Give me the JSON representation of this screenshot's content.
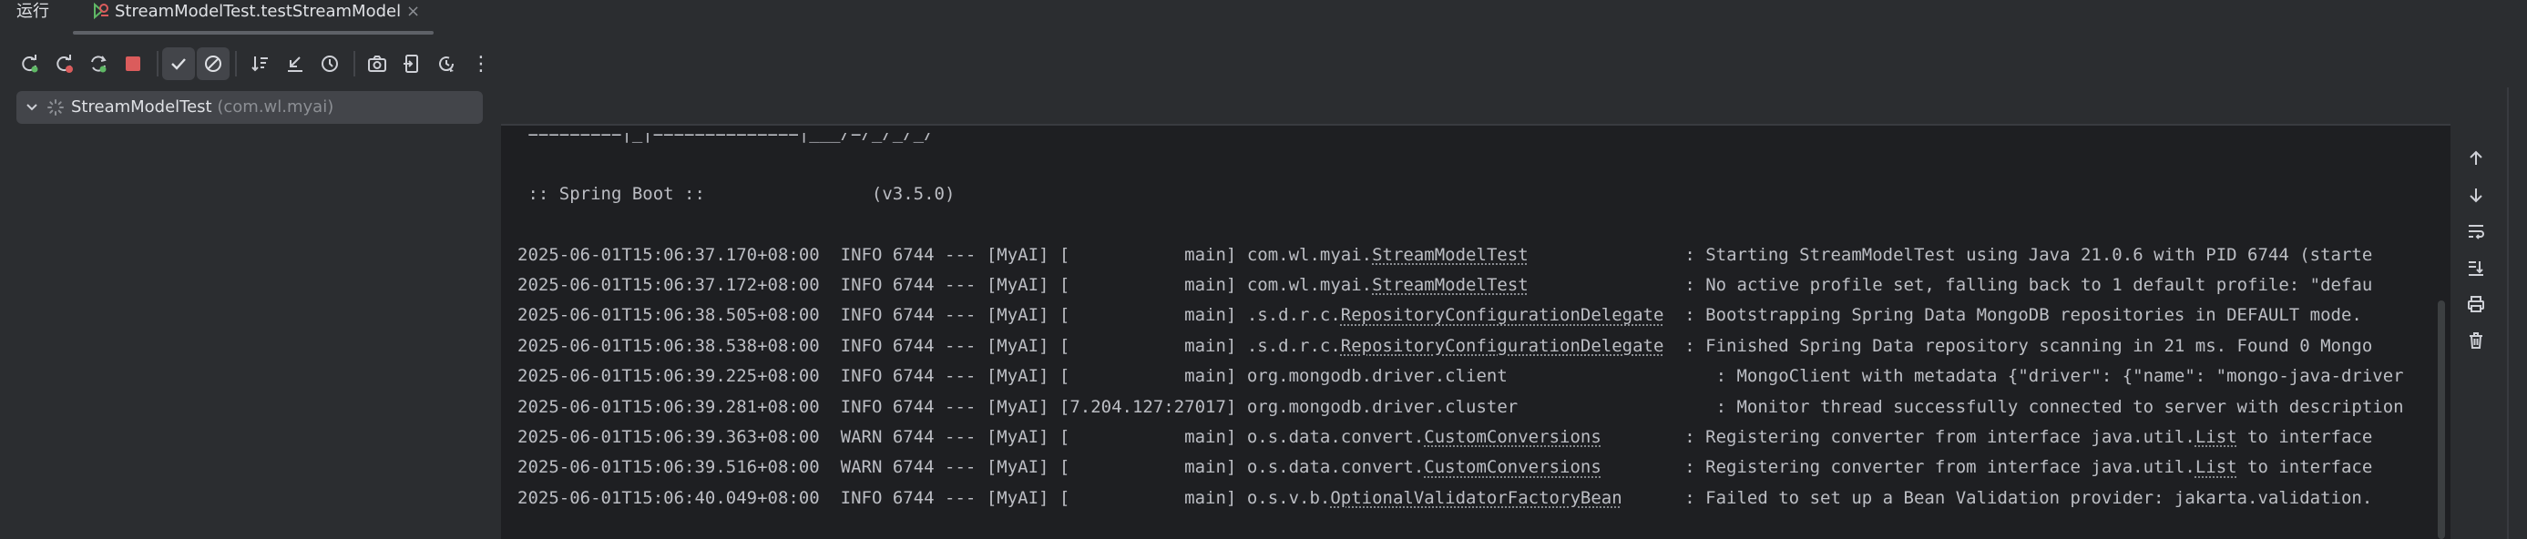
{
  "window": {
    "panel_title": "运行",
    "run_tab": {
      "label": "StreamModelTest.testStreamModel",
      "close_glyph": "×"
    }
  },
  "toolbar": {
    "buttons": [
      "rerun-icon",
      "rerun-failed-icon",
      "toggle-auto-test-icon",
      "stop-icon",
      "show-passed-icon",
      "show-ignored-icon",
      "sort-alphabetically-icon",
      "collapse-all-icon",
      "sort-by-duration-icon",
      "screenshot-icon",
      "import-tests-icon",
      "test-history-icon",
      "more-icon"
    ],
    "more_glyph": "⋮"
  },
  "tree": {
    "root": {
      "name": "StreamModelTest",
      "package": "(com.wl.myai)"
    }
  },
  "console": {
    "banner": {
      "ascii_line": " =========|_|==============|___/=/_/_/_/",
      "spring_line": " :: Spring Boot ::                (v3.5.0)"
    },
    "lines": [
      {
        "ts": "2025-06-01T15:06:37.170+08:00",
        "level": "INFO",
        "pid": "6744",
        "app": "[MyAI]",
        "thread": "[           main]",
        "logger_prefix": "com.wl.myai.",
        "logger_cls": "StreamModelTest",
        "pad": "              ",
        "message": ": Starting StreamModelTest using Java 21.0.6 with PID 6744 (starte"
      },
      {
        "ts": "2025-06-01T15:06:37.172+08:00",
        "level": "INFO",
        "pid": "6744",
        "app": "[MyAI]",
        "thread": "[           main]",
        "logger_prefix": "com.wl.myai.",
        "logger_cls": "StreamModelTest",
        "pad": "              ",
        "message": ": No active profile set, falling back to 1 default profile: \"defau"
      },
      {
        "ts": "2025-06-01T15:06:38.505+08:00",
        "level": "INFO",
        "pid": "6744",
        "app": "[MyAI]",
        "thread": "[           main]",
        "logger_prefix": ".s.d.r.c.",
        "logger_cls": "RepositoryConfigurationDelegate",
        "pad": " ",
        "message": ": Bootstrapping Spring Data MongoDB repositories in DEFAULT mode."
      },
      {
        "ts": "2025-06-01T15:06:38.538+08:00",
        "level": "INFO",
        "pid": "6744",
        "app": "[MyAI]",
        "thread": "[           main]",
        "logger_prefix": ".s.d.r.c.",
        "logger_cls": "RepositoryConfigurationDelegate",
        "pad": " ",
        "message": ": Finished Spring Data repository scanning in 21 ms. Found 0 Mongo"
      },
      {
        "ts": "2025-06-01T15:06:39.225+08:00",
        "level": "INFO",
        "pid": "6744",
        "app": "[MyAI]",
        "thread": "[           main]",
        "logger_prefix": "org.mongodb.driver.client",
        "logger_cls": "",
        "pad": "                   ",
        "message": ": MongoClient with metadata {\"driver\": {\"name\": \"mongo-java-driver"
      },
      {
        "ts": "2025-06-01T15:06:39.281+08:00",
        "level": "INFO",
        "pid": "6744",
        "app": "[MyAI]",
        "thread": "[7.204.127:27017]",
        "logger_prefix": "org.mongodb.driver.cluster",
        "logger_cls": "",
        "pad": "                  ",
        "message": ": Monitor thread successfully connected to server with description"
      },
      {
        "ts": "2025-06-01T15:06:39.363+08:00",
        "level": "WARN",
        "pid": "6744",
        "app": "[MyAI]",
        "thread": "[           main]",
        "logger_prefix": "o.s.data.convert.",
        "logger_cls": "CustomConversions",
        "pad": "       ",
        "message": ": Registering converter from interface java.util.",
        "msg_cls": "List",
        "msg_tail": " to interface"
      },
      {
        "ts": "2025-06-01T15:06:39.516+08:00",
        "level": "WARN",
        "pid": "6744",
        "app": "[MyAI]",
        "thread": "[           main]",
        "logger_prefix": "o.s.data.convert.",
        "logger_cls": "CustomConversions",
        "pad": "       ",
        "message": ": Registering converter from interface java.util.",
        "msg_cls": "List",
        "msg_tail": " to interface"
      },
      {
        "ts": "2025-06-01T15:06:40.049+08:00",
        "level": "INFO",
        "pid": "6744",
        "app": "[MyAI]",
        "thread": "[           main]",
        "logger_prefix": "o.s.v.b.",
        "logger_cls": "OptionalValidatorFactoryBean",
        "pad": "     ",
        "message": ": Failed to set up a Bean Validation provider: jakarta.validation."
      }
    ]
  },
  "side_tools": [
    "scroll-up-icon",
    "scroll-down-icon",
    "soft-wrap-icon",
    "scroll-to-end-icon",
    "print-icon",
    "clear-all-icon"
  ],
  "colors": {
    "background": "#2b2d30",
    "console_background": "#1e1f22",
    "text": "#dfe1e5",
    "console_text": "#bcbec4",
    "muted": "#8c8f94",
    "stop_red": "#db5c5c",
    "rerun_green": "#5fb865"
  }
}
